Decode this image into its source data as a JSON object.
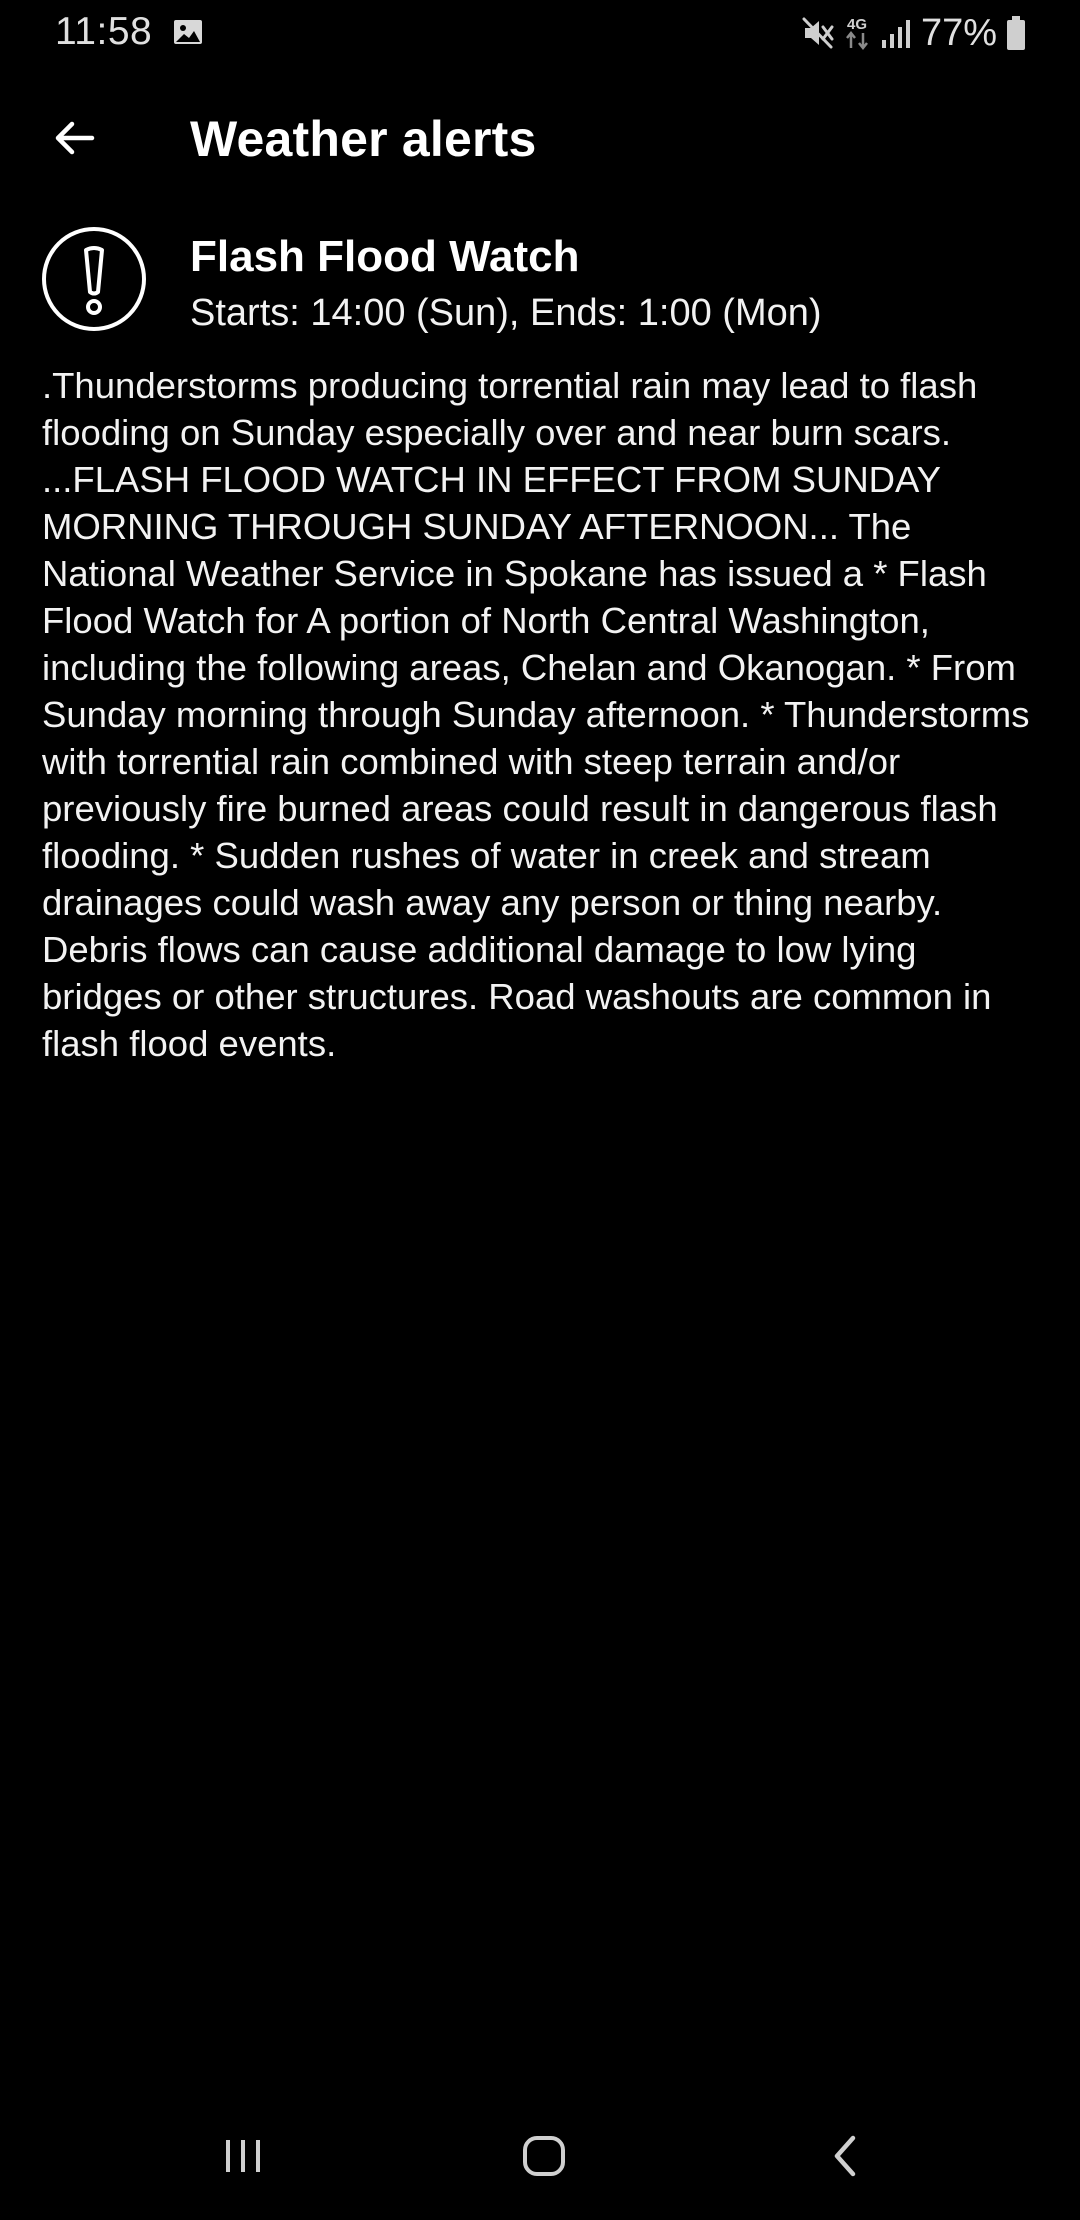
{
  "status_bar": {
    "time": "11:58",
    "icons": [
      "gallery-icon",
      "mute-icon",
      "4g-data-icon",
      "signal-icon",
      "battery-icon"
    ],
    "network_label": "4G",
    "battery_percent": "77%"
  },
  "app_bar": {
    "title": "Weather alerts",
    "back_icon": "arrow-left-icon"
  },
  "alert": {
    "icon": "exclamation-circle-icon",
    "title": "Flash Flood Watch",
    "times": "Starts: 14:00 (Sun), Ends: 1:00 (Mon)",
    "body": ".Thunderstorms producing torrential rain may lead to flash flooding on Sunday especially over and near burn scars. ...FLASH FLOOD WATCH IN EFFECT FROM SUNDAY MORNING THROUGH SUNDAY AFTERNOON... The National Weather Service in Spokane has issued a * Flash Flood Watch for A portion of North Central Washington, including the following areas, Chelan and Okanogan. * From Sunday morning through Sunday afternoon. * Thunderstorms with torrential rain combined with steep terrain and/or previously fire burned areas could result in dangerous flash flooding. * Sudden rushes of water in creek and stream drainages could wash away any person or thing nearby. Debris flows can cause additional damage to low lying bridges or other structures. Road washouts are common in flash flood events."
  },
  "nav_bar": {
    "icons": [
      "recents-icon",
      "home-icon",
      "back-icon"
    ]
  }
}
